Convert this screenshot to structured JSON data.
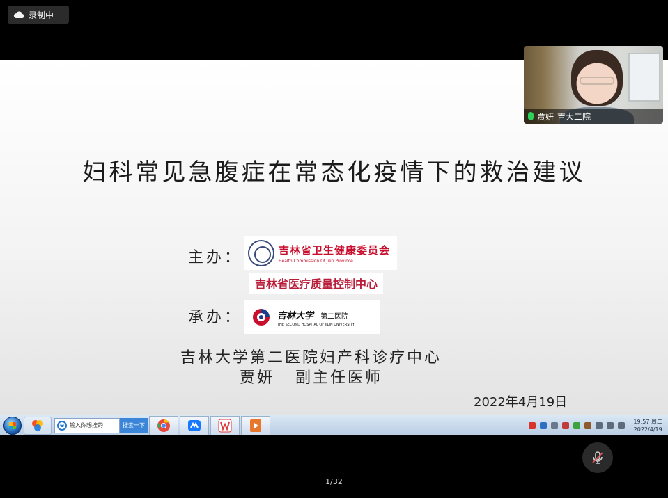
{
  "recording": {
    "label": "录制中",
    "icon": "cloud-icon"
  },
  "slide": {
    "title": "妇科常见急腹症在常态化疫情下的救治建议",
    "host_label": "主办：",
    "organizer_label": "承办：",
    "host_logo": {
      "name_cn": "吉林省卫生健康委员会",
      "name_en": "Health Commission Of Jilin Province"
    },
    "qc_logo": {
      "text": "吉林省医疗质量控制中心"
    },
    "hospital_logo": {
      "calligraphy": "吉林大学",
      "dept": "第二医院",
      "name_en": "THE SECOND HOSPITAL OF JILIN UNIVERSITY"
    },
    "department": "吉林大学第二医院妇产科诊疗中心",
    "presenter": "贾妍   副主任医师",
    "date": "2022年4月19日"
  },
  "camera": {
    "name": "贾妍",
    "org": "吉大二院"
  },
  "taskbar": {
    "search_placeholder": "输入你想搜的",
    "search_button": "搜索一下",
    "clock_time": "19:57 周二",
    "clock_date": "2022/4/19"
  },
  "pager": {
    "text": "1/32"
  },
  "colors": {
    "accent_red": "#c8102e",
    "mic_green": "#2ed15d",
    "taskbar": "#b9cde3"
  }
}
